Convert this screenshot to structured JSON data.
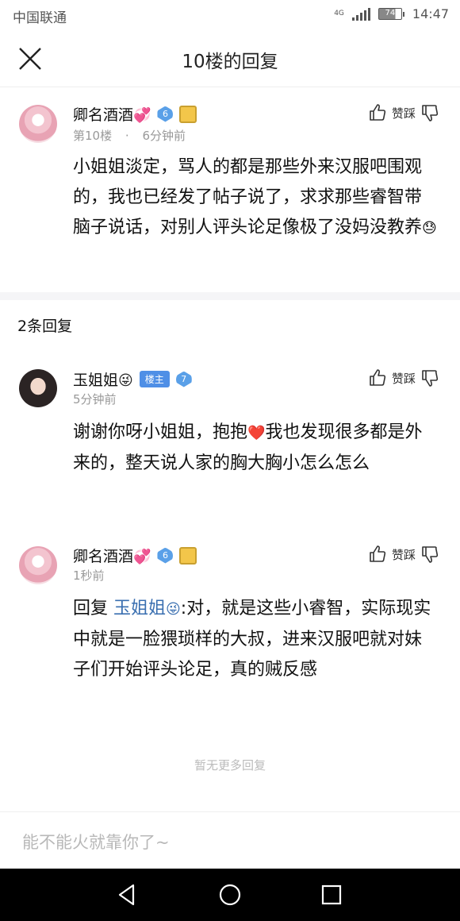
{
  "status_bar": {
    "carrier": "中国联通",
    "network": "4G",
    "battery": "74",
    "time": "14:47"
  },
  "header": {
    "title": "10楼的回复",
    "close_icon": "close-icon"
  },
  "main_post": {
    "username": "卿名酒酒",
    "username_emoji": "💞",
    "level": "6",
    "floor": "第10楼",
    "separator": "·",
    "time": "6分钟前",
    "vote_label": "赞踩",
    "content": "小姐姐淡定，骂人的都是那些外来汉服吧围观的，我也已经发了帖子说了，求求那些睿智带脑子说话，对别人评头论足像极了没妈没教养",
    "content_emoji": "😓"
  },
  "replies_header": {
    "count_label": "2条回复"
  },
  "replies": [
    {
      "username": "玉姐姐",
      "username_emoji": "😜",
      "author_badge": "楼主",
      "level": "7",
      "time": "5分钟前",
      "vote_label": "赞踩",
      "content_part1": "谢谢你呀小姐姐，抱抱",
      "content_emoji": "❤️",
      "content_part2": "我也发现很多都是外来的，整天说人家的胸大胸小怎么怎么"
    },
    {
      "username": "卿名酒酒",
      "username_emoji": "💞",
      "level": "6",
      "time": "1秒前",
      "vote_label": "赞踩",
      "reply_prefix": "回复",
      "mention": "玉姐姐",
      "mention_emoji": "😜",
      "content": ":对，就是这些小睿智，实际现实中就是一脸猥琐样的大叔，进来汉服吧就对妹子们开始评头论足，真的贼反感"
    }
  ],
  "footer": {
    "no_more": "暂无更多回复",
    "input_placeholder": "能不能火就靠你了~"
  },
  "colors": {
    "accent_blue": "#4f8fe6",
    "mention_blue": "#3a6fb0",
    "meta_gray": "#999999"
  }
}
